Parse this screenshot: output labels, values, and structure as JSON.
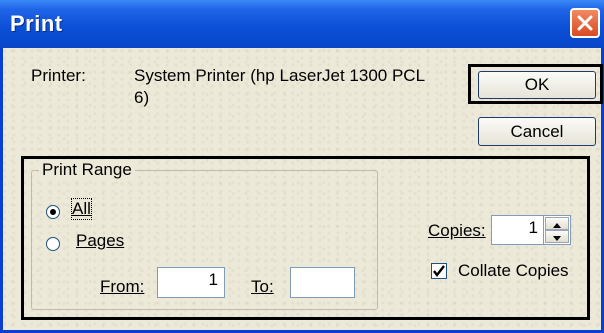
{
  "window": {
    "title": "Print"
  },
  "printer": {
    "label": "Printer:",
    "value_line1": "System Printer (hp LaserJet 1300 PCL",
    "value_line2": "6)"
  },
  "buttons": {
    "ok": "OK",
    "cancel": "Cancel"
  },
  "print_range": {
    "legend": "Print Range",
    "all_label": "All",
    "pages_label": "Pages",
    "from_label": "From:",
    "from_value": "1",
    "to_label": "To:",
    "to_value": "",
    "selected": "All"
  },
  "copies": {
    "label": "Copies:",
    "value": "1"
  },
  "collate": {
    "label": "Collate Copies",
    "checked": true
  },
  "colors": {
    "title_bar": "#0a4fd6",
    "background": "#ece9d8",
    "close": "#d84a22"
  },
  "icons": [
    "close-icon",
    "spin-up-icon",
    "spin-down-icon",
    "checkmark-icon"
  ]
}
